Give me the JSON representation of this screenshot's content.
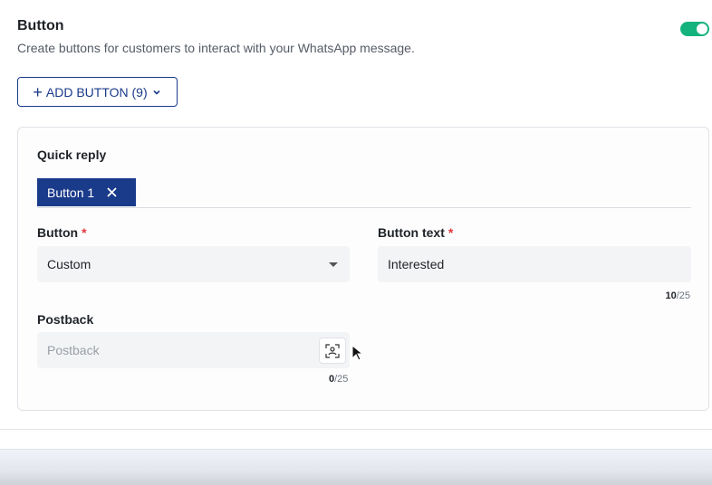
{
  "section": {
    "title": "Button",
    "description": "Create buttons for customers to interact with your WhatsApp message.",
    "enabled": true,
    "toggle_color": "#14b37d"
  },
  "add_button": {
    "icon": "plus-icon",
    "label": "ADD BUTTON (9)",
    "chevron": "chevron-down-icon"
  },
  "card": {
    "heading": "Quick reply",
    "tabs": [
      {
        "label": "Button 1",
        "close_icon": "close-icon"
      }
    ],
    "button_field": {
      "label": "Button",
      "required": "*",
      "value": "Custom"
    },
    "button_text_field": {
      "label": "Button text",
      "required": "*",
      "value": "Interested",
      "count": "10",
      "max": "/25"
    },
    "postback_field": {
      "label": "Postback",
      "placeholder": "Postback",
      "count": "0",
      "max": "/25",
      "icon": "contact-scan-icon"
    }
  },
  "accent": "#1a3a8a"
}
